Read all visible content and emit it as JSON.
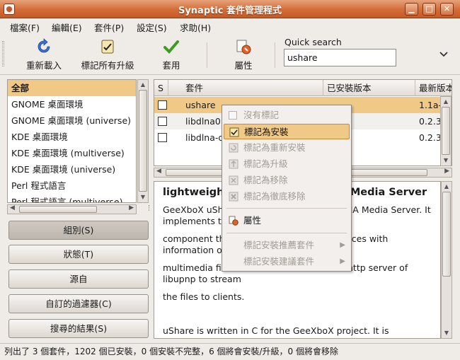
{
  "window": {
    "title": "Synaptic 套件管理程式"
  },
  "menubar": [
    {
      "label": "檔案(F)"
    },
    {
      "label": "編輯(E)"
    },
    {
      "label": "套件(P)"
    },
    {
      "label": "設定(S)"
    },
    {
      "label": "求助(H)"
    }
  ],
  "toolbar": {
    "reload": "重新載入",
    "mark_all_upgrades": "標記所有升級",
    "apply": "套用",
    "properties": "屬性"
  },
  "search": {
    "label": "Quick search",
    "value": "ushare"
  },
  "filters": [
    {
      "label": "全部",
      "selected": true
    },
    {
      "label": "GNOME 桌面環境"
    },
    {
      "label": "GNOME 桌面環境 (universe)"
    },
    {
      "label": "KDE 桌面環境"
    },
    {
      "label": "KDE 桌面環境 (multiverse)"
    },
    {
      "label": "KDE 桌面環境 (universe)"
    },
    {
      "label": "Perl 程式語言"
    },
    {
      "label": "Perl 程式語言 (multiverse)"
    }
  ],
  "side_buttons": [
    {
      "label": "組別(S)",
      "active": true
    },
    {
      "label": "狀態(T)"
    },
    {
      "label": "源自"
    },
    {
      "label": "自訂的過濾器(C)"
    },
    {
      "label": "搜尋的結果(S)"
    }
  ],
  "table": {
    "columns": [
      "S",
      "套件",
      "已安裝版本",
      "最新版本"
    ],
    "rows": [
      {
        "name": "ushare",
        "installed": "",
        "latest": "1.1a-0ub",
        "selected": true
      },
      {
        "name": "libdlna0",
        "installed": "",
        "latest": "0.2.3-0ub"
      },
      {
        "name": "libdlna-dev",
        "installed": "",
        "latest": "0.2.3-0ub"
      }
    ]
  },
  "description": {
    "title": "lightweight UPnP A/V and DLNA Media Server",
    "paragraphs": [
      "GeeXboX uShare is a UPnP (TM) A/V & DLNA Media Server. It implements the server",
      "component that provides UPnP media devices with information on available",
      "multimedia files. uShare uses the built-in http server of libupnp to stream",
      "the files to clients.",
      "",
      "uShare is written in C for the GeeXboX project. It is designed to provide"
    ]
  },
  "context_menu": {
    "items": [
      {
        "label": "沒有標記",
        "enabled": false,
        "icon": "checkbox-empty-icon"
      },
      {
        "label": "標記為安裝",
        "enabled": true,
        "highlighted": true,
        "icon": "install-mark-icon"
      },
      {
        "label": "標記為重新安裝",
        "enabled": false,
        "icon": "reinstall-icon"
      },
      {
        "label": "標記為升級",
        "enabled": false,
        "icon": "upgrade-icon"
      },
      {
        "label": "標記為移除",
        "enabled": false,
        "icon": "remove-icon"
      },
      {
        "label": "標記為徹底移除",
        "enabled": false,
        "icon": "purge-icon"
      },
      {
        "label": "屬性",
        "enabled": true,
        "icon": "properties-icon"
      },
      {
        "label": "標記安裝推薦套件",
        "enabled": false,
        "submenu": true
      },
      {
        "label": "標記安裝建議套件",
        "enabled": false,
        "submenu": true
      }
    ]
  },
  "status": {
    "text": "列出了 3 個套件，1202 個已安裝，0 個安裝不完整，6 個將會安裝/升級，0 個將會移除"
  },
  "colors": {
    "title_bar": "#d46c37",
    "selection": "#f1c987",
    "window_bg": "#efebe7"
  }
}
